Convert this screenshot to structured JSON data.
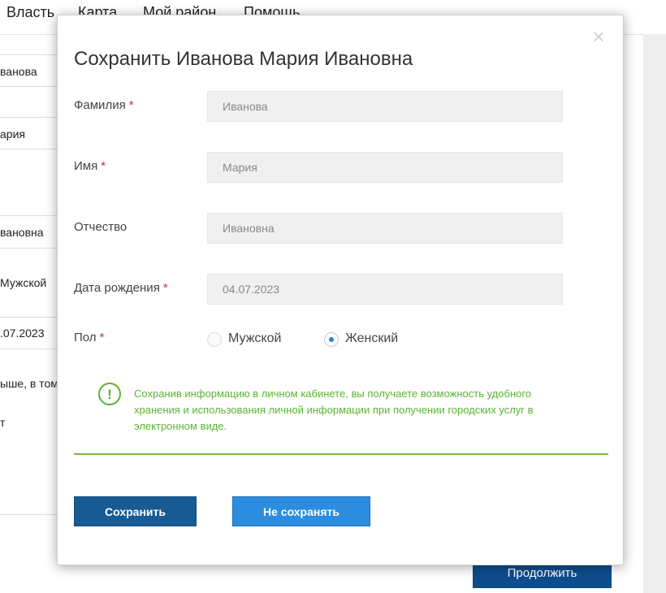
{
  "background": {
    "nav": [
      "Власть",
      "Карта",
      "Мой район",
      "Помощь"
    ],
    "fields": [
      "ванова",
      "",
      "ария",
      "",
      "вановна",
      "Мужской",
      ".07.2023",
      "ыше, в том",
      "т"
    ],
    "continue_button": "Продолжить"
  },
  "modal": {
    "title": "Сохранить Иванова Мария Ивановна",
    "close_symbol": "×",
    "fields": {
      "last_name": {
        "label": "Фамилия",
        "required": "*",
        "value": "Иванова"
      },
      "first_name": {
        "label": "Имя",
        "required": "*",
        "value": "Мария"
      },
      "patronymic": {
        "label": "Отчество",
        "value": "Ивановна"
      },
      "birth_date": {
        "label": "Дата рождения",
        "required": "*",
        "value": "04.07.2023"
      }
    },
    "gender": {
      "label": "Пол",
      "required": "*",
      "options": [
        {
          "label": "Мужской",
          "checked": false
        },
        {
          "label": "Женский",
          "checked": true
        }
      ]
    },
    "notice": {
      "icon": "!",
      "text": "Сохранив информацию в личном кабинете, вы получаете возможность удобного хранения и использования личной информации при получении городских услуг в электронном виде."
    },
    "buttons": {
      "save": "Сохранить",
      "no_save": "Не сохранять"
    }
  },
  "colors": {
    "primary": "#185a94",
    "secondary": "#2c8ce0",
    "notice_green": "#5bb431",
    "required_red": "#c0392b"
  }
}
